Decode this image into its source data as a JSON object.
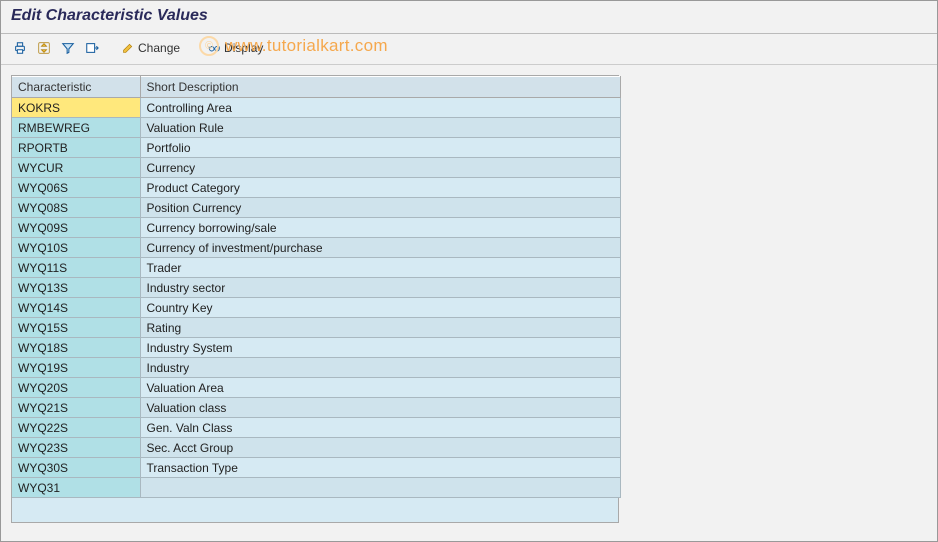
{
  "title": "Edit Characteristic Values",
  "toolbar": {
    "change_label": "Change",
    "display_label": "Display"
  },
  "watermark": {
    "symbol": "©",
    "text": "www.tutorialkart.com"
  },
  "table": {
    "headers": {
      "characteristic": "Characteristic",
      "description": "Short Description"
    },
    "rows": [
      {
        "key": "KOKRS",
        "desc": "Controlling Area",
        "selected": true
      },
      {
        "key": "RMBEWREG",
        "desc": "Valuation Rule"
      },
      {
        "key": "RPORTB",
        "desc": "Portfolio"
      },
      {
        "key": "WYCUR",
        "desc": "Currency"
      },
      {
        "key": "WYQ06S",
        "desc": "Product Category"
      },
      {
        "key": "WYQ08S",
        "desc": "Position Currency"
      },
      {
        "key": "WYQ09S",
        "desc": "Currency borrowing/sale"
      },
      {
        "key": "WYQ10S",
        "desc": "Currency of investment/purchase"
      },
      {
        "key": "WYQ11S",
        "desc": "Trader"
      },
      {
        "key": "WYQ13S",
        "desc": "Industry sector"
      },
      {
        "key": "WYQ14S",
        "desc": "Country Key"
      },
      {
        "key": "WYQ15S",
        "desc": "Rating"
      },
      {
        "key": "WYQ18S",
        "desc": "Industry System"
      },
      {
        "key": "WYQ19S",
        "desc": "Industry"
      },
      {
        "key": "WYQ20S",
        "desc": "Valuation Area"
      },
      {
        "key": "WYQ21S",
        "desc": "Valuation class"
      },
      {
        "key": "WYQ22S",
        "desc": "Gen. Valn Class"
      },
      {
        "key": "WYQ23S",
        "desc": "Sec. Acct Group"
      },
      {
        "key": "WYQ30S",
        "desc": "Transaction Type"
      },
      {
        "key": "WYQ31",
        "desc": ""
      }
    ]
  }
}
